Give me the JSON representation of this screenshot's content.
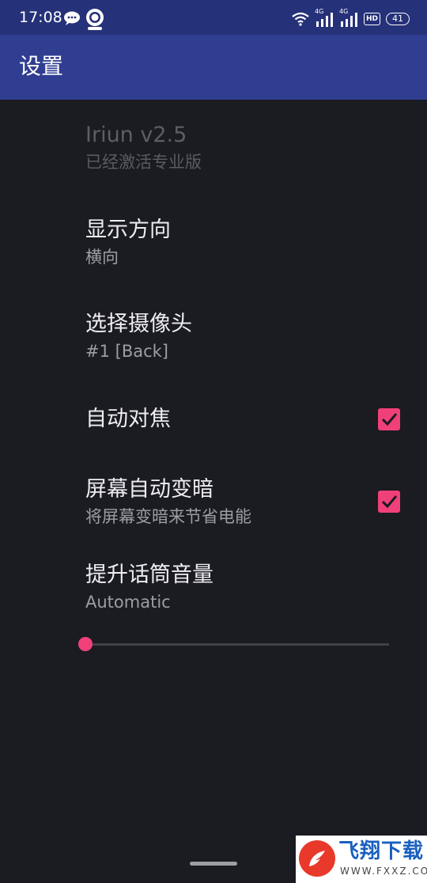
{
  "status_bar": {
    "time": "17:08",
    "signal_1_label": "4G",
    "signal_2_label": "4G",
    "hd_label": "HD",
    "battery_level": "41"
  },
  "app_bar": {
    "title": "设置"
  },
  "preferences": {
    "version": {
      "title": "Iriun v2.5",
      "summary": "已经激活专业版"
    },
    "orientation": {
      "title": "显示方向",
      "summary": "横向"
    },
    "camera": {
      "title": "选择摄像头",
      "summary": "#1 [Back]"
    },
    "autofocus": {
      "title": "自动对焦",
      "checked": true
    },
    "dim_screen": {
      "title": "屏幕自动变暗",
      "summary": "将屏幕变暗来节省电能",
      "checked": true
    },
    "mic_boost": {
      "title": "提升话筒音量",
      "summary": "Automatic",
      "slider_value": 0
    }
  },
  "watermark": {
    "brand": "飞翔下载",
    "domain": "WWW.FXXZ.COM"
  },
  "colors": {
    "status_bar": "#253178",
    "app_bar": "#303e91",
    "background": "#1b1b22",
    "accent": "#f0407a"
  }
}
